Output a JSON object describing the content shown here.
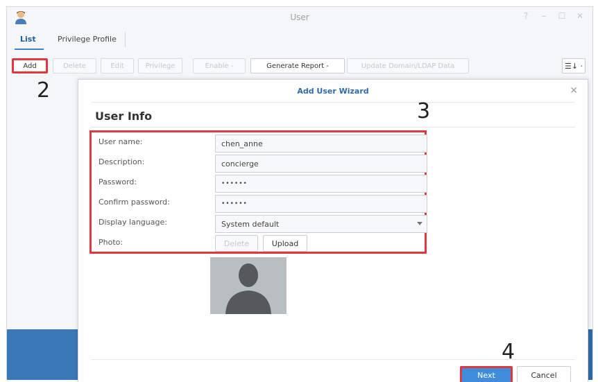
{
  "window": {
    "title": "User",
    "controls": [
      "?",
      "–",
      "☐",
      "✕"
    ]
  },
  "tabs": [
    {
      "label": "List",
      "active": true
    },
    {
      "label": "Privilege Profile",
      "active": false
    }
  ],
  "toolbar": {
    "add": "Add",
    "delete": "Delete",
    "edit": "Edit",
    "privilege": "Privilege",
    "enable": "Enable -",
    "generate_report": "Generate Report -",
    "update_domain": "Update Domain/LDAP Data",
    "view_toggle": "☰↓ ·"
  },
  "callouts": {
    "step2": "2",
    "step3": "3",
    "step4": "4"
  },
  "dialog": {
    "title": "Add User Wizard",
    "close": "✕",
    "section_title": "User Info",
    "fields": {
      "username": {
        "label": "User name:",
        "value": "chen_anne"
      },
      "description": {
        "label": "Description:",
        "value": "concierge"
      },
      "password": {
        "label": "Password:",
        "value": "••••••"
      },
      "confirm_password": {
        "label": "Confirm password:",
        "value": "••••••"
      },
      "display_language": {
        "label": "Display language:",
        "value": "System default"
      },
      "photo": {
        "label": "Photo:",
        "delete": "Delete",
        "upload": "Upload"
      }
    },
    "footer": {
      "next": "Next",
      "cancel": "Cancel"
    }
  },
  "colors": {
    "highlight": "#e0383e",
    "accent": "#3f8ddb",
    "title_blue": "#2f6aa8",
    "background_strip": "#3b78b8"
  }
}
